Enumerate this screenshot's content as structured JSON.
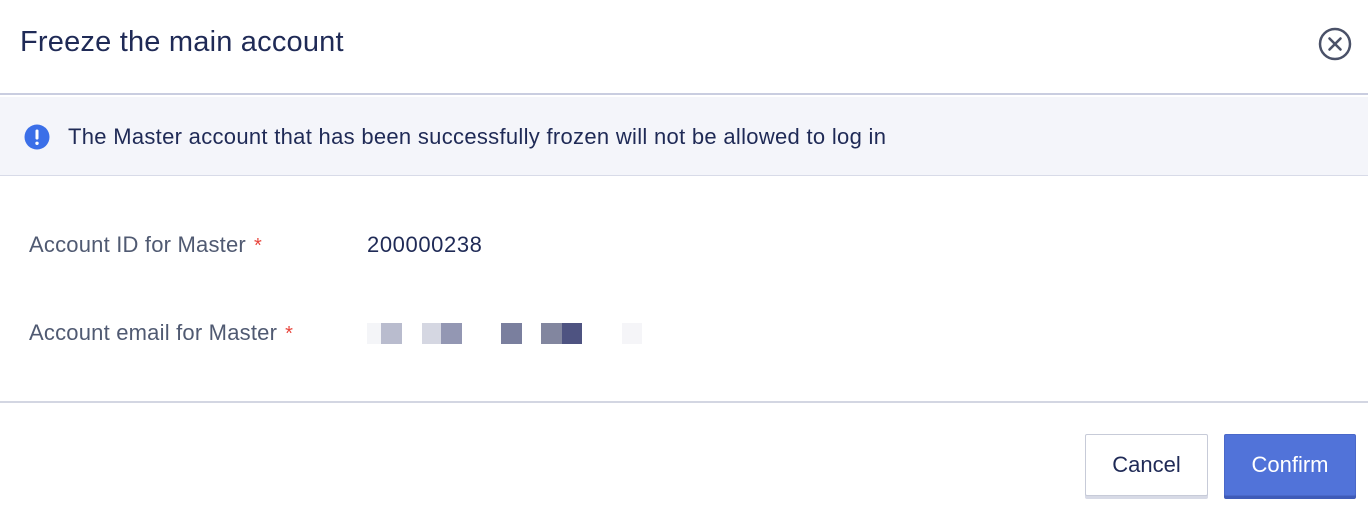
{
  "dialog": {
    "title": "Freeze the main account",
    "close_icon": "close-circle-icon"
  },
  "notice": {
    "icon": "exclamation-circle-icon",
    "text": "The Master account that has been successfully frozen will not be allowed to log in",
    "icon_color": "#3b6fe8"
  },
  "form": {
    "account_id": {
      "label": "Account ID for Master",
      "required_mark": "*",
      "value": "200000238"
    },
    "account_email": {
      "label": "Account email for Master",
      "required_mark": "*",
      "value_redacted": true
    }
  },
  "footer": {
    "cancel_label": "Cancel",
    "confirm_label": "Confirm"
  },
  "colors": {
    "primary": "#5173d9",
    "text_dark": "#1f2a56",
    "required": "#e8453c"
  }
}
